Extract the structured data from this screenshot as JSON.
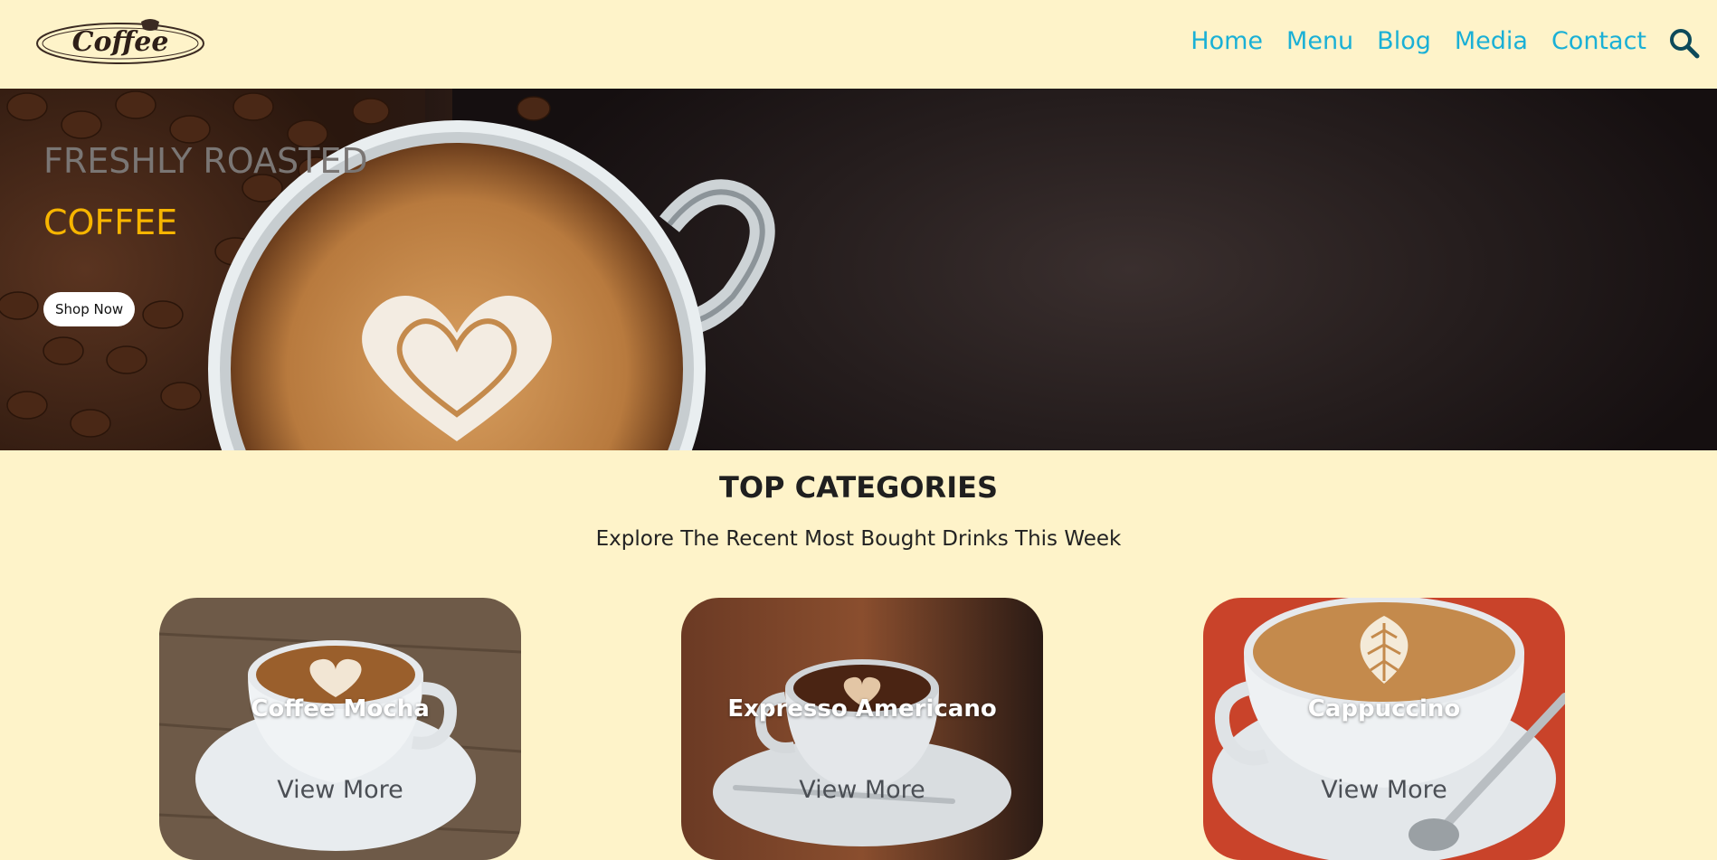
{
  "header": {
    "logo_text": "Coffee",
    "nav": [
      "Home",
      "Menu",
      "Blog",
      "Media",
      "Contact"
    ]
  },
  "hero": {
    "title_line1": "FRESHLY ROASTED",
    "title_line2": "COFFEE",
    "button": "Shop Now"
  },
  "categories": {
    "title": "TOP CATEGORIES",
    "subtitle": "Explore The Recent Most Bought Drinks This Week",
    "cards": [
      {
        "name": "Coffee Mocha",
        "link": "View More"
      },
      {
        "name": "Expresso Americano",
        "link": "View More"
      },
      {
        "name": "Cappuccino",
        "link": "View More"
      }
    ]
  },
  "colors": {
    "background": "#fef3c9",
    "nav_link": "#1ab0d6",
    "accent": "#f7b500"
  }
}
